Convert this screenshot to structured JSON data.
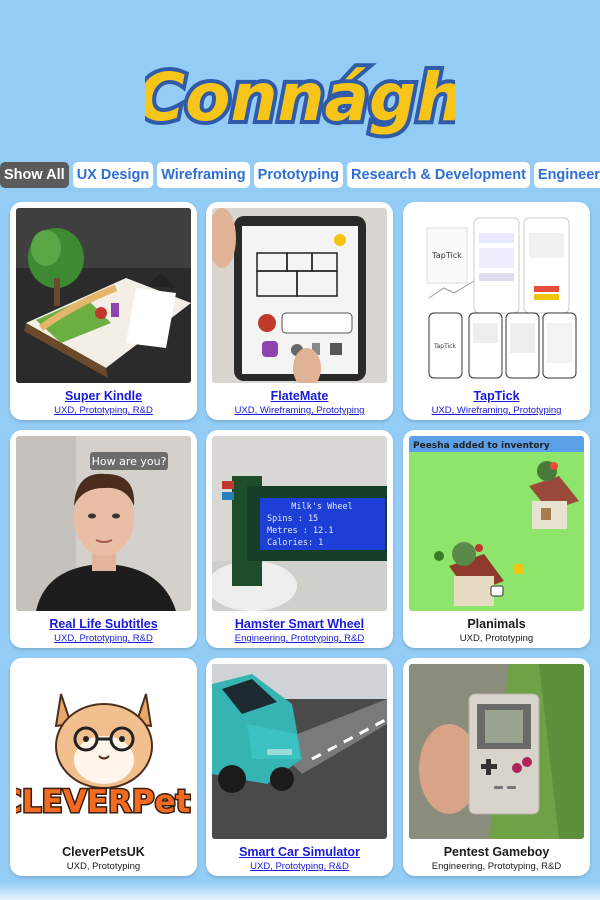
{
  "site": {
    "logo_text": "Connágh"
  },
  "filters": [
    {
      "label": "Show All",
      "active": true
    },
    {
      "label": "UX Design",
      "active": false
    },
    {
      "label": "Wireframing",
      "active": false
    },
    {
      "label": "Prototyping",
      "active": false
    },
    {
      "label": "Research & Development",
      "active": false
    },
    {
      "label": "Engineering",
      "active": false
    }
  ],
  "projects": [
    {
      "title": "Super Kindle",
      "tags": "UXD, Prototyping, R&D",
      "link": true
    },
    {
      "title": "FlateMate",
      "tags": "UXD, Wireframing, Prototyping",
      "link": true
    },
    {
      "title": "TapTick",
      "tags": "UXD, Wireframing, Prototyping",
      "link": true
    },
    {
      "title": "Real Life Subtitles",
      "tags": "UXD, Prototyping, R&D",
      "link": true
    },
    {
      "title": "Hamster Smart Wheel",
      "tags": "Engineering, Prototyping, R&D",
      "link": true
    },
    {
      "title": "Planimals",
      "tags": "UXD, Prototyping",
      "link": false
    },
    {
      "title": "CleverPetsUK",
      "tags": "UXD, Prototyping",
      "link": false
    },
    {
      "title": "Smart Car Simulator",
      "tags": "UXD, Prototyping, R&D",
      "link": true
    },
    {
      "title": "Pentest Gameboy",
      "tags": "Engineering, Prototyping, R&D",
      "link": false
    }
  ],
  "thumb_text": {
    "subtitle_bubble": "How are you?",
    "lcd_line1": "Milk's Wheel",
    "lcd_line2": "Spins   : 15",
    "lcd_line3": "Metres  : 12.1",
    "lcd_line4": "Calories: 1",
    "planimals_banner": "Peesha added to inventory",
    "cleverpets_logo": "CLEVERPets",
    "taptick_logo": "TapTick"
  },
  "colors": {
    "background": "#93cdf6",
    "filter_active_bg": "#5b5b5b",
    "filter_text": "#2d6fd6",
    "link": "#1a1adb"
  }
}
